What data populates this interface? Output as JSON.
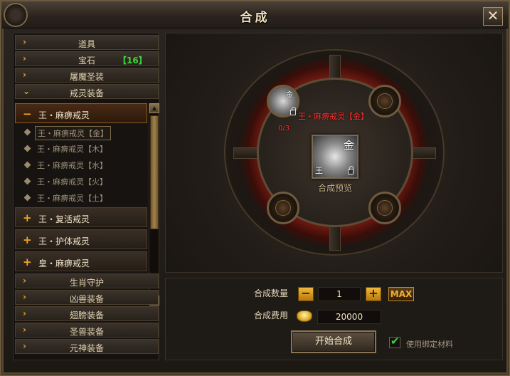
{
  "window": {
    "title": "合成",
    "close_symbol": "✕"
  },
  "sidebar": {
    "categories_top": [
      {
        "label": "道具",
        "count": ""
      },
      {
        "label": "宝石",
        "count": "【16】"
      },
      {
        "label": "屠魔圣装",
        "count": ""
      },
      {
        "label": "戒灵装备",
        "count": "",
        "expanded": true
      }
    ],
    "groups": [
      {
        "label": "王・麻痹戒灵",
        "symbol": "−",
        "active": true,
        "items": [
          {
            "label": "王・麻痹戒灵【金】",
            "selected": true
          },
          {
            "label": "王・麻痹戒灵【木】"
          },
          {
            "label": "王・麻痹戒灵【水】"
          },
          {
            "label": "王・麻痹戒灵【火】"
          },
          {
            "label": "王・麻痹戒灵【土】"
          }
        ]
      },
      {
        "label": "王・复活戒灵",
        "symbol": "+"
      },
      {
        "label": "王・护体戒灵",
        "symbol": "+"
      },
      {
        "label": "皇・麻痹戒灵",
        "symbol": "+"
      }
    ],
    "categories_bottom": [
      {
        "label": "生肖守护"
      },
      {
        "label": "凶兽装备"
      },
      {
        "label": "翅膀装备"
      },
      {
        "label": "圣兽装备"
      },
      {
        "label": "元神装备"
      }
    ],
    "arrow_symbol": "›",
    "expanded_arrow_symbol": "⌄"
  },
  "synthesis": {
    "material_slot": {
      "element_tag": "金",
      "name_label": "王・麻痹戒灵【金】",
      "count": "0/3"
    },
    "preview": {
      "element_tag": "金",
      "rank_tag": "王",
      "label": "合成预览"
    }
  },
  "controls": {
    "quantity_label": "合成数量",
    "quantity_value": "1",
    "minus_symbol": "−",
    "plus_symbol": "+",
    "max_label": "MAX",
    "cost_label": "合成费用",
    "cost_value": "20000",
    "start_button": "开始合成",
    "bind_label": "使用绑定材料",
    "bind_checked": true,
    "check_symbol": "✔"
  },
  "colors": {
    "accent": "#f0a020",
    "gem_count": "#39d839",
    "warning": "#ff3030",
    "check": "#3bd83b"
  }
}
